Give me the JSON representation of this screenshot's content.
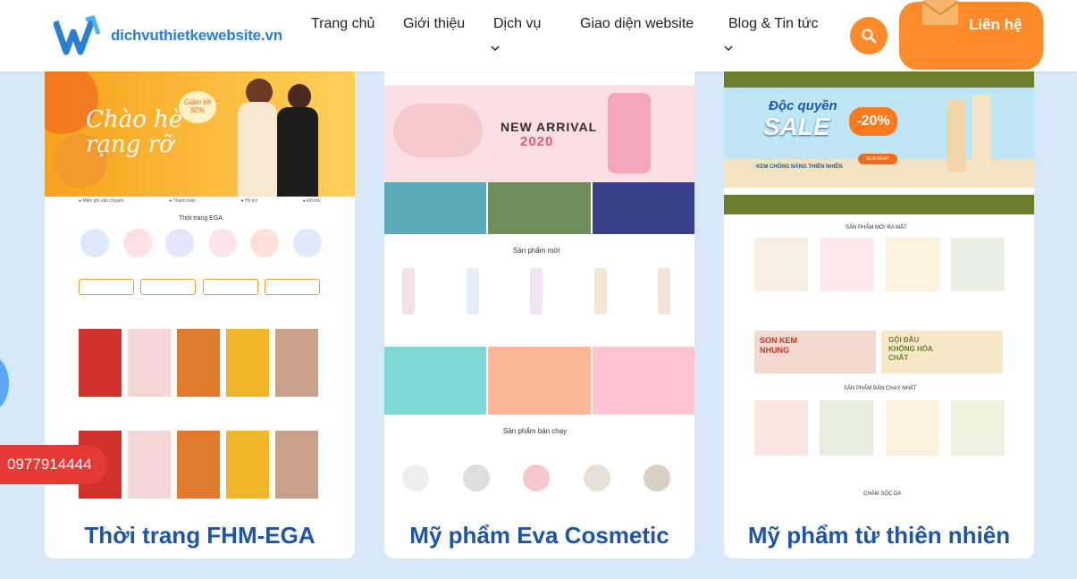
{
  "header": {
    "logo_text": "dichvuthietkewebsite.vn",
    "nav": [
      {
        "label": "Trang chủ",
        "has_dropdown": false
      },
      {
        "label": "Giới thiệu",
        "has_dropdown": false
      },
      {
        "label": "Dịch vụ",
        "has_dropdown": true
      },
      {
        "label": "Giao diện website",
        "has_dropdown": false
      },
      {
        "label": "Blog & Tin tức",
        "has_dropdown": true
      }
    ],
    "contact_label": "Liên hệ",
    "search_icon": "search-icon",
    "accent_color": "#ff8a2a",
    "brand_color": "#2a7fd4"
  },
  "cards": [
    {
      "title": "Thời trang FHM-EGA",
      "banner_text": "Chào hè rạng rỡ",
      "banner_badge": "Giảm tới 50%",
      "section_title": "Thời trang EGA"
    },
    {
      "title": "Mỹ phẩm Eva Cosmetic",
      "banner_text": "NEW ARRIVAL",
      "banner_year": "2020",
      "section_new": "Sản phẩm mới",
      "section_best": "Sản phẩm bán chạy"
    },
    {
      "title": "Mỹ phẩm từ thiên nhiên",
      "banner_line1": "Độc quyền",
      "banner_line2": "SALE",
      "banner_badge": "-20%",
      "banner_sub": "KEM CHỐNG NẮNG THIÊN NHIÊN",
      "banner_cta": "MUA NGAY",
      "section_new": "SẢN PHẨM MỚI RA MẮT",
      "promo_left": "SON KEM NHUNG",
      "promo_right": "GỘI ĐẦU KHÔNG HÓA CHẤT",
      "section_best": "SẢN PHẨM BÁN CHẠY NHẤT",
      "section_care": "CHĂM SÓC DA"
    }
  ],
  "floating": {
    "phone": "0977914444"
  }
}
